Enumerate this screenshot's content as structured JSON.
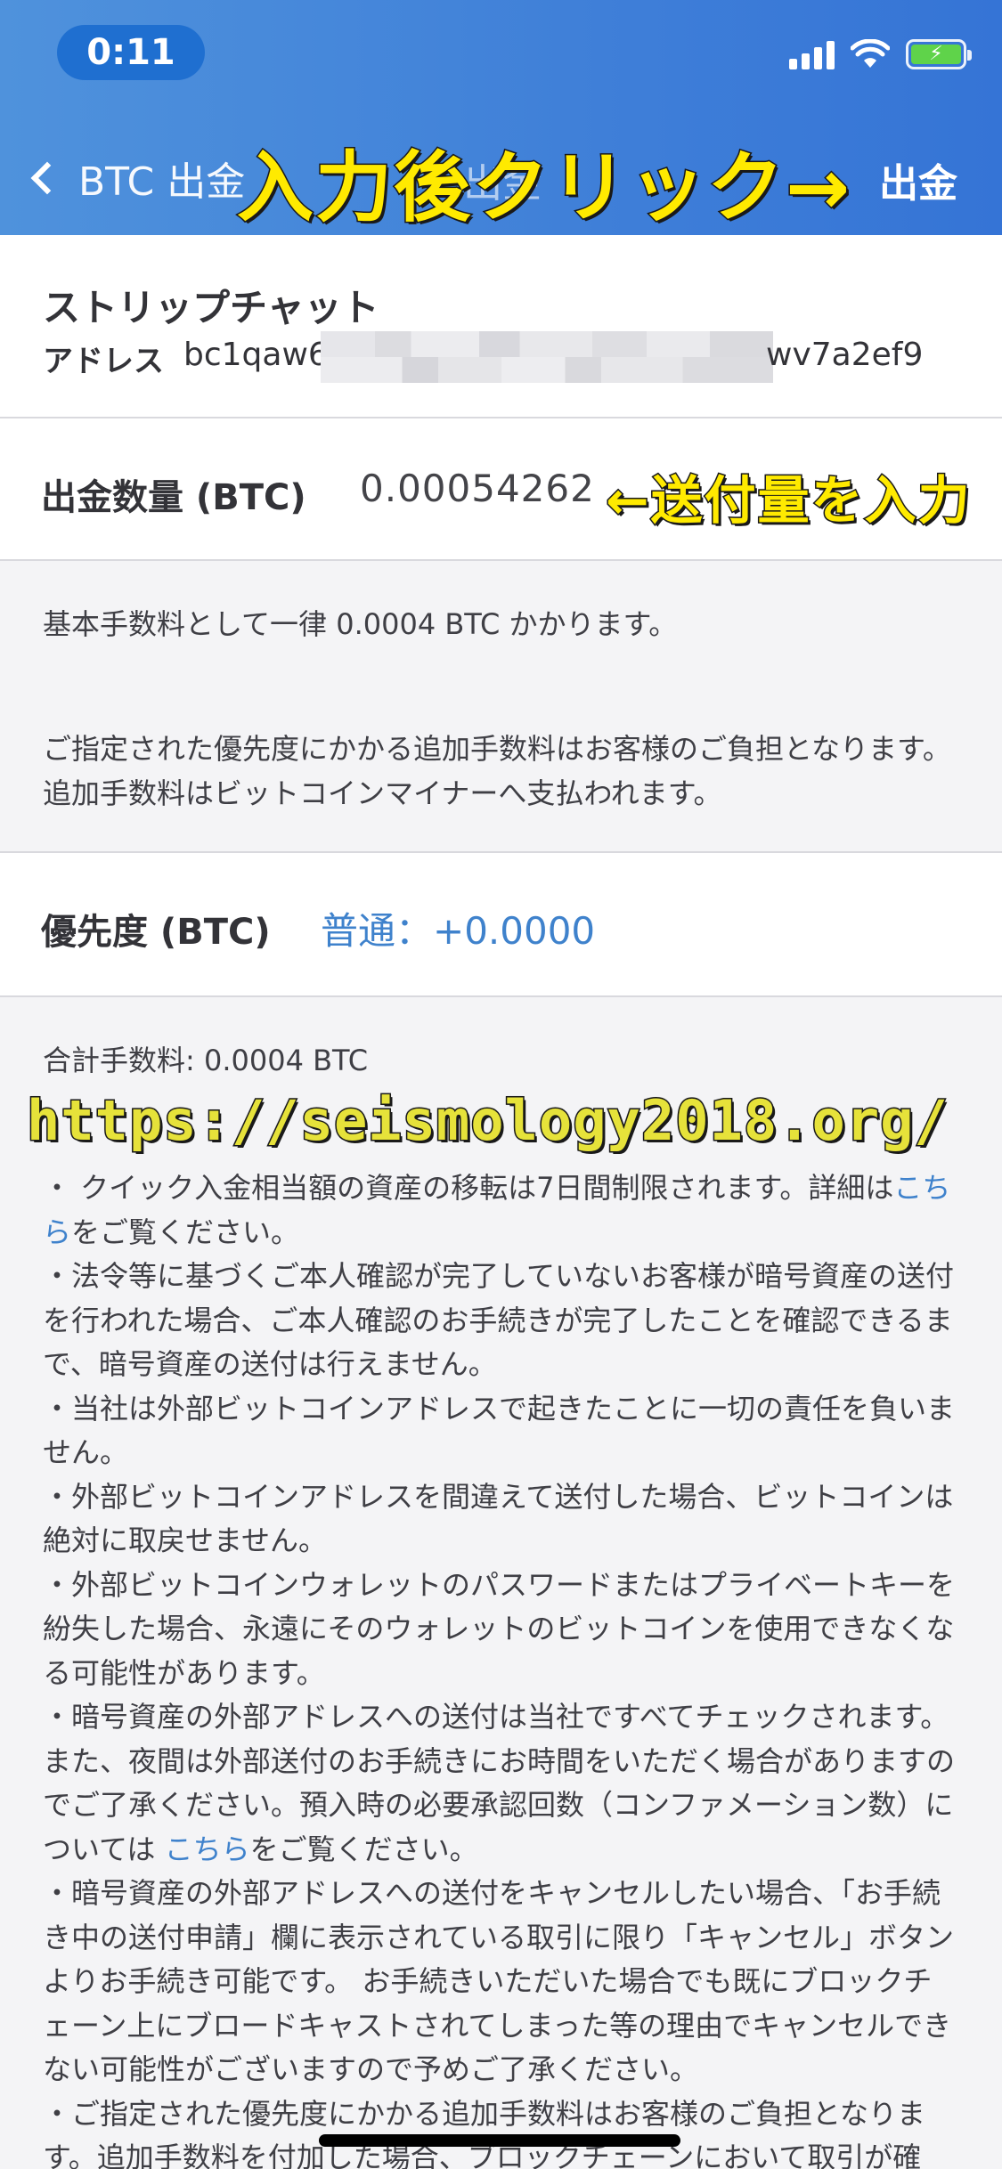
{
  "status_bar": {
    "time": "0:11",
    "icons": [
      "signal-icon",
      "wifi-icon",
      "battery-charging-icon"
    ]
  },
  "nav": {
    "back_label": "BTC 出金",
    "title": "出金",
    "submit_label": "出金"
  },
  "annotations": {
    "top": "入力後クリック→",
    "amount": "←送付量を入力",
    "url": "https://seismology2018.org/"
  },
  "recipient": {
    "name": "ストリップチャット",
    "address_label": "アドレス",
    "address_prefix": "bc1qaw62",
    "address_suffix": "wv7a2ef9"
  },
  "amount": {
    "label": "出金数量 (BTC)",
    "value": "0.00054262"
  },
  "fee_note_1": "基本手数料として一律 0.0004 BTC かかります。",
  "fee_note_2": "ご指定された優先度にかかる追加手数料はお客様のご負担となります。追加手数料はビットコインマイナーへ支払われます。",
  "priority": {
    "label": "優先度 (BTC)",
    "value": "普通：+0.0000"
  },
  "total_fee": "合計手数料: 0.0004 BTC",
  "notices": {
    "n1_pre": "・ クイック入金相当額の資産の移転は7日間制限されます。詳細は",
    "n1_link": "こちら",
    "n1_post": "をご覧ください。",
    "n2": "・法令等に基づくご本人確認が完了していないお客様が暗号資産の送付を行われた場合、ご本人確認のお手続きが完了したことを確認できるまで、暗号資産の送付は行えません。",
    "n3": "・当社は外部ビットコインアドレスで起きたことに一切の責任を負いません。",
    "n4": "・外部ビットコインアドレスを間違えて送付した場合、ビットコインは絶対に取戻せません。",
    "n5": "・外部ビットコインウォレットのパスワードまたはプライベートキーを紛失した場合、永遠にそのウォレットのビットコインを使用できなくなる可能性があります。",
    "n6_pre": "・暗号資産の外部アドレスへの送付は当社ですべてチェックされます。また、夜間は外部送付のお手続きにお時間をいただく場合がありますのでご了承ください。預入時の必要承認回数（コンファメーション数）については ",
    "n6_link": "こちら",
    "n6_post": "をご覧ください。",
    "n7": "・暗号資産の外部アドレスへの送付をキャンセルしたい場合、「お手続き中の送付申請」欄に表示されている取引に限り「キャンセル」ボタンよりお手続き可能です。 お手続きいただいた場合でも既にブロックチェーン上にブロードキャストされてしまった等の理由でキャンセルできない可能性がございますので予めご了承ください。",
    "n8": "・ご指定された優先度にかかる追加手数料はお客様のご負担となります。追加手数料を付加した場合、ブロックチェーンにおいて取引が確"
  },
  "colors": {
    "header": "#3f7fd8",
    "link": "#3f82cc",
    "annotation": "#ffea00"
  }
}
